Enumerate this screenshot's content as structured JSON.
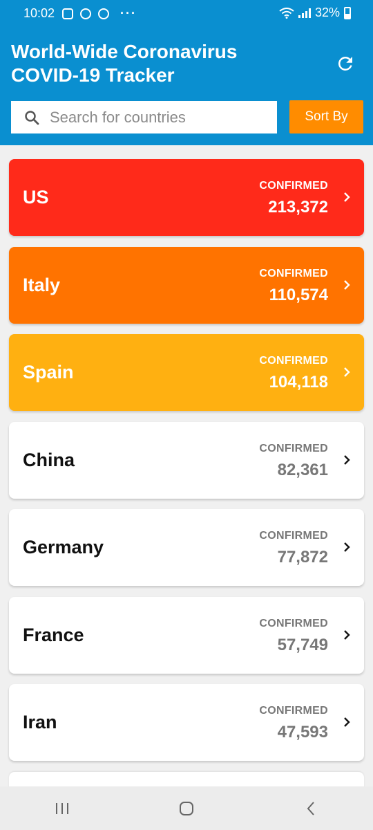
{
  "status": {
    "time": "10:02",
    "battery": "32%",
    "notification_icons": [
      "instagram-icon",
      "hand-icon",
      "whatsapp-icon"
    ],
    "more": "···"
  },
  "header": {
    "title_line1": "World-Wide Coronavirus",
    "title_line2": "COVID-19 Tracker",
    "refresh_icon": "refresh-icon",
    "background": "#0a8fd0"
  },
  "search": {
    "placeholder": "Search for countries",
    "value": "",
    "icon": "search-icon"
  },
  "sort": {
    "label": "Sort By",
    "color": "#ff8c00"
  },
  "countries": [
    {
      "name": "US",
      "label": "CONFIRMED",
      "count": "213,372",
      "color": "#ff2a1a"
    },
    {
      "name": "Italy",
      "label": "CONFIRMED",
      "count": "110,574",
      "color": "#ff7300"
    },
    {
      "name": "Spain",
      "label": "CONFIRMED",
      "count": "104,118",
      "color": "#ffb011"
    },
    {
      "name": "China",
      "label": "CONFIRMED",
      "count": "82,361",
      "color": "#ffffff"
    },
    {
      "name": "Germany",
      "label": "CONFIRMED",
      "count": "77,872",
      "color": "#ffffff"
    },
    {
      "name": "France",
      "label": "CONFIRMED",
      "count": "57,749",
      "color": "#ffffff"
    },
    {
      "name": "Iran",
      "label": "CONFIRMED",
      "count": "47,593",
      "color": "#ffffff"
    }
  ],
  "navbar": {
    "recents_icon": "recents-icon",
    "home_icon": "home-icon",
    "back_icon": "back-icon"
  }
}
